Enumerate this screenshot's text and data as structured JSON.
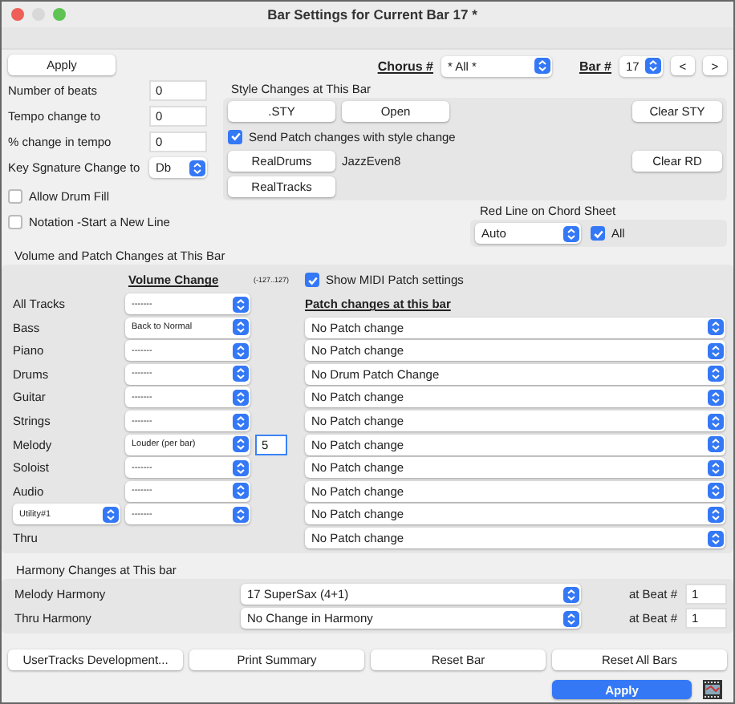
{
  "window": {
    "title": "Bar Settings for Current Bar 17 *"
  },
  "top_apply": "Apply",
  "chorus": {
    "label": "Chorus #",
    "value": "* All *"
  },
  "bar": {
    "label": "Bar #",
    "value": "17",
    "prev": "<",
    "next": ">"
  },
  "fields": [
    {
      "label": "Number of beats",
      "kind": "input",
      "value": "0"
    },
    {
      "label": "Tempo change to",
      "kind": "input",
      "value": "0"
    },
    {
      "label": "% change in tempo",
      "kind": "input",
      "value": "0"
    },
    {
      "label": "Key Sgnature Change to",
      "kind": "select",
      "value": "Db"
    }
  ],
  "options": [
    {
      "label": "Allow Drum Fill",
      "checked": false
    },
    {
      "label": "Notation -Start a New Line",
      "checked": false
    }
  ],
  "style_changes": {
    "title": "Style Changes at This Bar",
    "sty_button": ".STY",
    "open_button": "Open",
    "clear_sty_button": "Clear STY",
    "send_patch": {
      "label": "Send Patch changes with style change",
      "checked": true
    },
    "realdrums_button": "RealDrums",
    "realdrums_value": "JazzEven8",
    "clear_rd_button": "Clear RD",
    "realtracks_button": "RealTracks"
  },
  "red_line": {
    "title": "Red Line on Chord Sheet",
    "value": "Auto",
    "all": {
      "label": "All",
      "checked": true
    }
  },
  "volume_patch": {
    "title": "Volume and Patch Changes at This Bar",
    "volume_header": "Volume Change",
    "range_hint": "(-127..127)",
    "show_midi": {
      "label": "Show MIDI Patch settings",
      "checked": true
    },
    "patch_header": "Patch changes at this bar",
    "tracks": [
      {
        "kind": "label",
        "name": "All Tracks",
        "volume": "-------"
      },
      {
        "kind": "label",
        "name": "Bass",
        "volume": "Back to Normal",
        "patch": "No Patch change"
      },
      {
        "kind": "label",
        "name": "Piano",
        "volume": "-------",
        "patch": "No Patch change"
      },
      {
        "kind": "label",
        "name": "Drums",
        "volume": "-------",
        "patch": "No Drum Patch Change"
      },
      {
        "kind": "label",
        "name": "Guitar",
        "volume": "-------",
        "patch": "No Patch change"
      },
      {
        "kind": "label",
        "name": "Strings",
        "volume": "-------",
        "patch": "No Patch change"
      },
      {
        "kind": "label",
        "name": "Melody",
        "volume": "Louder (per bar)",
        "amount": "5",
        "focused": true,
        "patch": "No Patch change"
      },
      {
        "kind": "label",
        "name": "Soloist",
        "volume": "-------",
        "patch": "No Patch change"
      },
      {
        "kind": "label",
        "name": "Audio",
        "volume": "-------",
        "patch": "No Patch change"
      },
      {
        "kind": "select",
        "name": "Utility#1",
        "volume": "-------",
        "patch": "No Patch change"
      },
      {
        "kind": "label",
        "name": "Thru",
        "patch": "No Patch change"
      }
    ]
  },
  "harmony": {
    "title": "Harmony Changes at This bar",
    "rows": [
      {
        "label": "Melody Harmony",
        "value": "17 SuperSax (4+1)",
        "beat_label": "at Beat #",
        "beat": "1"
      },
      {
        "label": "Thru Harmony",
        "value": "No Change in Harmony",
        "beat_label": "at Beat #",
        "beat": "1"
      }
    ]
  },
  "bottom_buttons": [
    "UserTracks Development...",
    "Print Summary",
    "Reset Bar",
    "Reset All Bars"
  ],
  "apply": "Apply"
}
